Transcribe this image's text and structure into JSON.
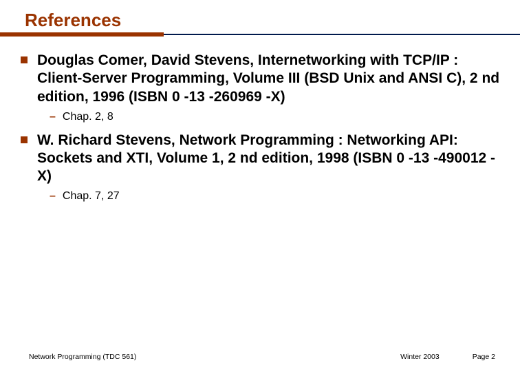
{
  "title": "References",
  "references": [
    {
      "text": "Douglas Comer, David Stevens, Internetworking with TCP/IP : Client-Server Programming, Volume III (BSD Unix and ANSI C), 2 nd edition, 1996 (ISBN 0 -13 -260969 -X)",
      "sub": "Chap. 2, 8"
    },
    {
      "text": "W. Richard Stevens, Network Programming : Networking API: Sockets and XTI, Volume 1, 2 nd edition, 1998 (ISBN 0 -13 -490012 -X)",
      "sub": "Chap. 7, 27"
    }
  ],
  "footer": {
    "left": "Network Programming (TDC 561)",
    "center": "Winter  2003",
    "right": "Page 2"
  }
}
